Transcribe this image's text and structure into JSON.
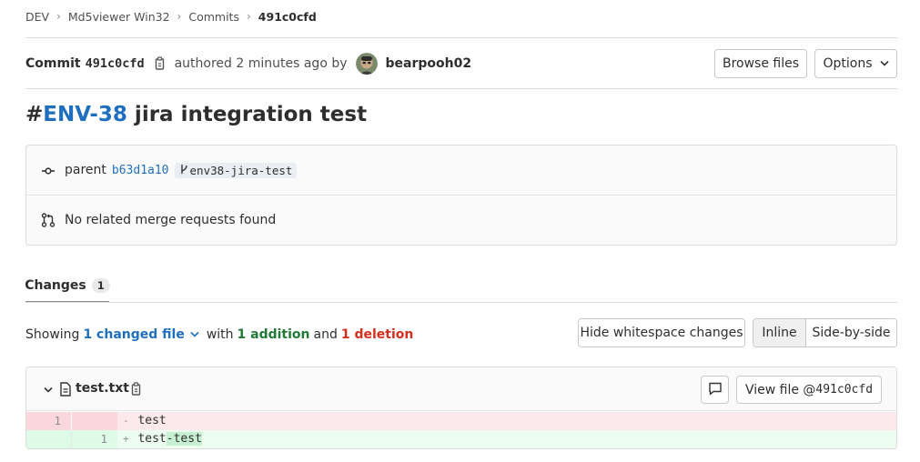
{
  "breadcrumb": {
    "items": [
      "DEV",
      "Md5viewer Win32",
      "Commits",
      "491c0cfd"
    ]
  },
  "commit": {
    "label": "Commit",
    "short_sha": "491c0cfd",
    "authored_text": "authored 2 minutes ago by",
    "author": "bearpooh02",
    "title_hash": "#",
    "title_issue": "ENV-38",
    "title_rest": " jira integration test",
    "parent_label": "parent",
    "parent_sha": "b63d1a10",
    "branch": "env38-jira-test",
    "merge_requests_text": "No related merge requests found"
  },
  "actions": {
    "browse_files": "Browse files",
    "options": "Options"
  },
  "tabs": {
    "changes_label": "Changes",
    "changes_count": "1"
  },
  "diff_stats": {
    "showing": "Showing",
    "files_changed": "1 changed file",
    "with": "with",
    "additions": "1 addition",
    "and": "and",
    "deletions": "1 deletion"
  },
  "diff_controls": {
    "hide_whitespace": "Hide whitespace changes",
    "inline": "Inline",
    "side_by_side": "Side-by-side",
    "view_mode": "inline"
  },
  "file": {
    "name": "test.txt",
    "view_file_label": "View file @",
    "view_file_sha": "491c0cfd",
    "lines": [
      {
        "type": "deletion",
        "old": "1",
        "new": "",
        "marker": "-",
        "text": "test"
      },
      {
        "type": "addition",
        "old": "",
        "new": "1",
        "marker": "+",
        "text": "test",
        "added": "-test"
      }
    ]
  },
  "colors": {
    "link": "#1f6fbf",
    "addition": "#217a35",
    "deletion": "#d22f1d",
    "deletion_bg": "#fbe9eb",
    "addition_bg": "#ecfdf0"
  }
}
